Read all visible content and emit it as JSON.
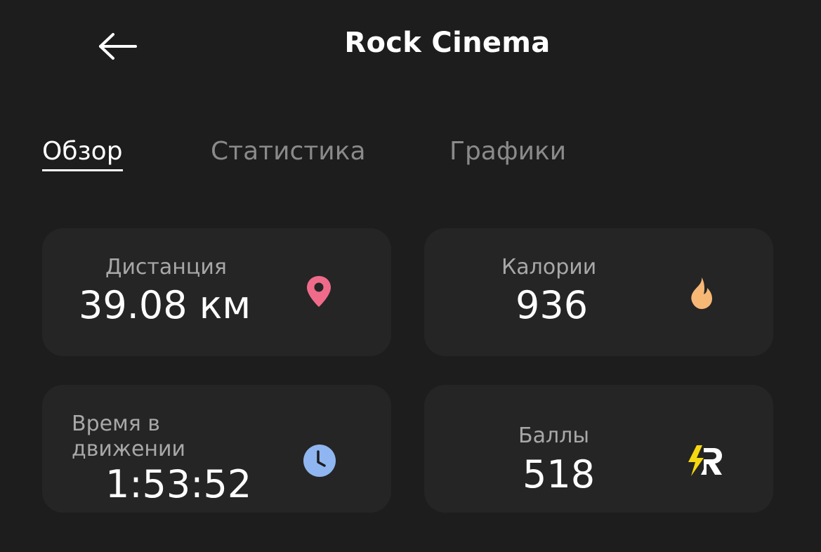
{
  "header": {
    "title": "Rock Cinema"
  },
  "tabs": [
    {
      "label": "Обзор",
      "active": true
    },
    {
      "label": "Статистика",
      "active": false
    },
    {
      "label": "Графики",
      "active": false
    }
  ],
  "stats": {
    "distance": {
      "label": "Дистанция",
      "value": "39.08 км",
      "icon": "location-pin-icon",
      "color": "#f06b8a"
    },
    "calories": {
      "label": "Калории",
      "value": "936",
      "icon": "flame-icon",
      "color": "#f7b876"
    },
    "moving_time": {
      "label": "Время в\nдвижении",
      "label_line1": "Время в",
      "label_line2": "движении",
      "value": "1:53:52",
      "icon": "clock-icon",
      "color": "#8fb6f0"
    },
    "points": {
      "label": "Баллы",
      "value": "518",
      "icon": "bolt-r-logo-icon",
      "color": "#f5d80f"
    }
  },
  "colors": {
    "background": "#1d1d1d",
    "card": "#252525",
    "text_primary": "#ffffff",
    "text_secondary": "#a8a8a8",
    "tab_inactive": "#8a8a8a"
  }
}
